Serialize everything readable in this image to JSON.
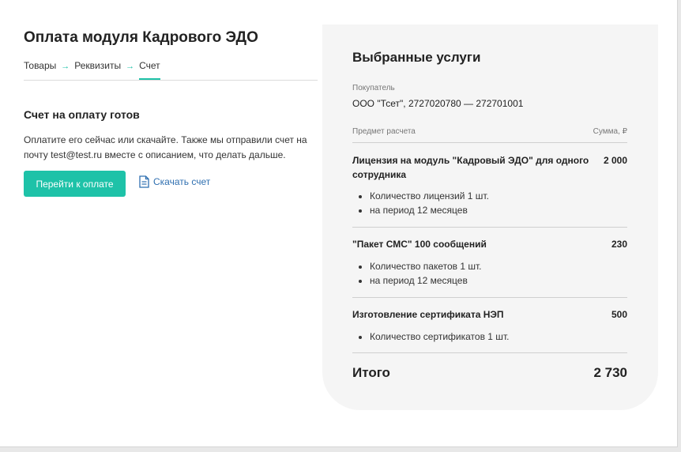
{
  "page": {
    "title": "Оплата модуля Кадрового ЭДО"
  },
  "breadcrumb": {
    "items": [
      "Товары",
      "Реквизиты",
      "Счет"
    ],
    "separator": "→",
    "active_index": 2
  },
  "invoice": {
    "heading": "Счет на оплату готов",
    "description": "Оплатите его сейчас или скачайте. Также мы отправили счет на почту test@test.ru вместе с описанием, что делать дальше.",
    "pay_button": "Перейти к оплате",
    "download_link": "Скачать счет"
  },
  "summary": {
    "title": "Выбранные услуги",
    "buyer_label": "Покупатель",
    "buyer_value": "ООО \"Тсет\", 2727020780 — 272701001",
    "col_item": "Предмет расчета",
    "col_amount": "Сумма, ₽",
    "items": [
      {
        "name": "Лицензия на модуль \"Кадровый ЭДО\" для одного сотрудника",
        "amount": "2 000",
        "details": [
          "Количество лицензий 1 шт.",
          "на период 12 месяцев"
        ]
      },
      {
        "name": "\"Пакет СМС\" 100 сообщений",
        "amount": "230",
        "details": [
          "Количество пакетов 1 шт.",
          "на период 12 месяцев"
        ]
      },
      {
        "name": "Изготовление сертификата НЭП",
        "amount": "500",
        "details": [
          "Количество сертификатов 1 шт."
        ]
      }
    ],
    "total_label": "Итого",
    "total_value": "2 730"
  },
  "colors": {
    "accent": "#1ec2a8",
    "link": "#2f6fb0",
    "panel_background": "#f5f5f5"
  },
  "icons": {
    "download": "document-icon"
  }
}
